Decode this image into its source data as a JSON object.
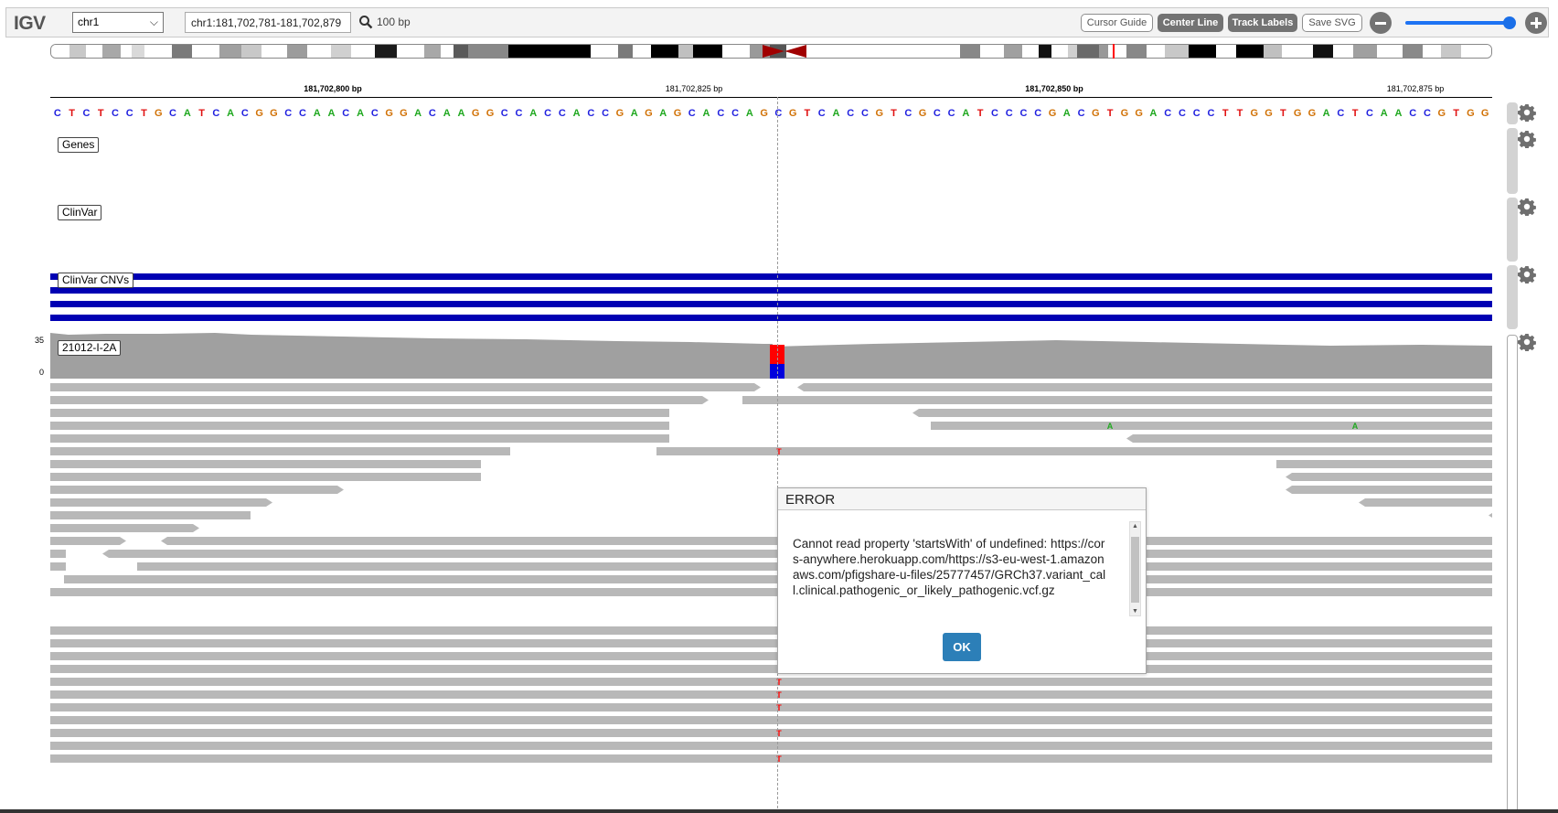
{
  "navbar": {
    "logo": "IGV",
    "chromosome": "chr1",
    "locus": "chr1:181,702,781-181,702,879",
    "window_size": "100 bp",
    "buttons": {
      "cursor_guide": "Cursor Guide",
      "center_line": "Center Line",
      "track_labels": "Track Labels",
      "save_svg": "Save SVG"
    },
    "zoom_level": 1.0
  },
  "ruler": {
    "ticks": [
      {
        "label": "181,702,800 bp",
        "major": true
      },
      {
        "label": "181,702,825 bp",
        "major": false
      },
      {
        "label": "181,702,850 bp",
        "major": true
      },
      {
        "label": "181,702,875 bp",
        "major": false
      }
    ]
  },
  "sequence": "CTCTCCTGCATCACGGCCAACACGGACAAGGCCACCACCGAGAGCACCAGCGTCACCGTCGCCATCCCCGACGTGGACCCCTTGGTGGACTCAACCGTGG",
  "base_colors": {
    "A": "#1fa81f",
    "C": "#1f1fdf",
    "G": "#d17105",
    "T": "#e01010"
  },
  "tracks": {
    "genes": "Genes",
    "clinvar": "ClinVar",
    "clinvar_cnvs": "ClinVar CNVs",
    "alignment": "21012-I-2A"
  },
  "coverage": {
    "max_label": "35",
    "min_label": "0",
    "mismatch_ref_color": "#ff0000",
    "mismatch_alt_color": "#0000dd"
  },
  "mismatches": {
    "t_base": "T",
    "a_base": "A"
  },
  "dialog": {
    "title": "ERROR",
    "message": "Cannot read property 'startsWith' of undefined: https://cors-anywhere.herokuapp.com/https://s3-eu-west-1.amazonaws.com/pfigshare-u-files/25777457/GRCh37.variant_call.clinical.pathogenic_or_likely_pathogenic.vcf.gz",
    "ok_label": "OK"
  }
}
